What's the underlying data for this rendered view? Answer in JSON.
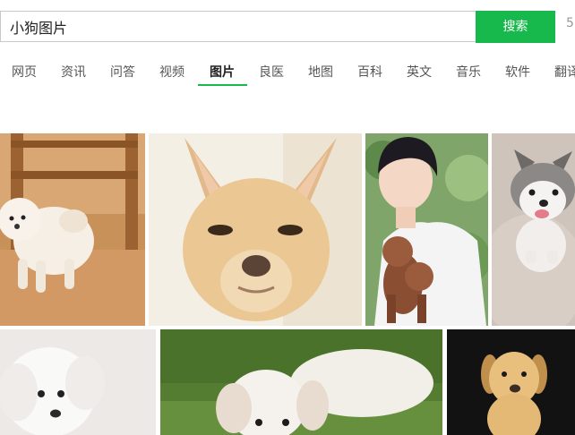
{
  "search": {
    "query": "小狗图片",
    "button_label": "搜索",
    "edge_char": "5"
  },
  "tabs": [
    {
      "label": "网页",
      "active": false
    },
    {
      "label": "资讯",
      "active": false
    },
    {
      "label": "问答",
      "active": false
    },
    {
      "label": "视频",
      "active": false
    },
    {
      "label": "图片",
      "active": true
    },
    {
      "label": "良医",
      "active": false
    },
    {
      "label": "地图",
      "active": false
    },
    {
      "label": "百科",
      "active": false
    },
    {
      "label": "英文",
      "active": false
    },
    {
      "label": "音乐",
      "active": false
    },
    {
      "label": "软件",
      "active": false
    },
    {
      "label": "翻译",
      "active": false
    }
  ],
  "colors": {
    "accent": "#18b94c"
  },
  "results": [
    {
      "subject": "white-puppy-on-wood-floor"
    },
    {
      "subject": "chihuahua-closeup"
    },
    {
      "subject": "boy-holding-brown-poodle"
    },
    {
      "subject": "husky-puppy"
    },
    {
      "subject": "white-fluffy-puppy"
    },
    {
      "subject": "cream-puppy-on-grass"
    },
    {
      "subject": "yellow-labrador-puppy"
    }
  ]
}
